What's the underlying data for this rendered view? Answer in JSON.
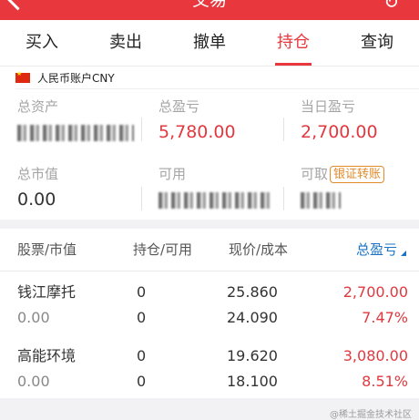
{
  "header": {
    "title": "交易"
  },
  "tabs": [
    {
      "label": "买入",
      "active": false
    },
    {
      "label": "卖出",
      "active": false
    },
    {
      "label": "撤单",
      "active": false
    },
    {
      "label": "持仓",
      "active": true
    },
    {
      "label": "查询",
      "active": false
    }
  ],
  "account": {
    "currency_label": "人民币账户CNY",
    "total_assets_label": "总资产",
    "total_pnl_label": "总盈亏",
    "total_pnl_value": "5,780.00",
    "daily_pnl_label": "当日盈亏",
    "daily_pnl_value": "2,700.00",
    "market_value_label": "总市值",
    "market_value_value": "0.00",
    "available_label": "可用",
    "withdrawable_label": "可取",
    "transfer_button": "银证转账"
  },
  "table": {
    "headers": [
      "股票/市值",
      "持仓/可用",
      "现价/成本",
      "总盈亏"
    ],
    "rows": [
      {
        "name": "钱江摩托",
        "market_value": "0.00",
        "position": "0",
        "available": "0",
        "price": "25.860",
        "cost": "24.090",
        "pnl": "2,700.00",
        "pnl_pct": "7.47%"
      },
      {
        "name": "高能环境",
        "market_value": "0.00",
        "position": "0",
        "available": "0",
        "price": "19.620",
        "cost": "18.100",
        "pnl": "3,080.00",
        "pnl_pct": "8.51%"
      }
    ]
  },
  "watermark": "@稀土掘金技术社区",
  "colors": {
    "brand_red": "#e8383d",
    "profit_red": "#e0393f",
    "sort_blue": "#1a73c4",
    "button_orange": "#e08a2a"
  }
}
